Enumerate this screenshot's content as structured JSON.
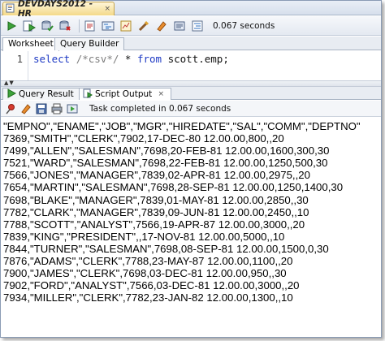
{
  "doc_tab": {
    "label": "DEVDAYS2012 - HR",
    "close": "×"
  },
  "toolbar": {
    "icons": [
      "run-statement-icon",
      "run-script-icon",
      "commit-icon",
      "rollback-icon",
      "unshared-worksheet-icon",
      "explain-plan-icon",
      "autotrace-icon",
      "sql-tuning-icon",
      "clear-icon",
      "history-icon",
      "format-icon"
    ],
    "elapsed": "0.067 seconds"
  },
  "sub_tabs": [
    "Worksheet",
    "Query Builder"
  ],
  "editor": {
    "line_number": "1",
    "tokens": {
      "kw1": "select",
      "comment": "/*csv*/",
      "star": " * ",
      "kw2": "from",
      "rest": " scott.emp;"
    }
  },
  "result_tabs": [
    {
      "label": "Query Result",
      "close": "×"
    },
    {
      "label": "Script Output",
      "close": "×"
    }
  ],
  "result_toolbar": {
    "status": "Task completed in 0.067 seconds"
  },
  "output_lines": [
    "\"EMPNO\",\"ENAME\",\"JOB\",\"MGR\",\"HIREDATE\",\"SAL\",\"COMM\",\"DEPTNO\"",
    "7369,\"SMITH\",\"CLERK\",7902,17-DEC-80 12.00.00,800,,20",
    "7499,\"ALLEN\",\"SALESMAN\",7698,20-FEB-81 12.00.00,1600,300,30",
    "7521,\"WARD\",\"SALESMAN\",7698,22-FEB-81 12.00.00,1250,500,30",
    "7566,\"JONES\",\"MANAGER\",7839,02-APR-81 12.00.00,2975,,20",
    "7654,\"MARTIN\",\"SALESMAN\",7698,28-SEP-81 12.00.00,1250,1400,30",
    "7698,\"BLAKE\",\"MANAGER\",7839,01-MAY-81 12.00.00,2850,,30",
    "7782,\"CLARK\",\"MANAGER\",7839,09-JUN-81 12.00.00,2450,,10",
    "7788,\"SCOTT\",\"ANALYST\",7566,19-APR-87 12.00.00,3000,,20",
    "7839,\"KING\",\"PRESIDENT\",,17-NOV-81 12.00.00,5000,,10",
    "7844,\"TURNER\",\"SALESMAN\",7698,08-SEP-81 12.00.00,1500,0,30",
    "7876,\"ADAMS\",\"CLERK\",7788,23-MAY-87 12.00.00,1100,,20",
    "7900,\"JAMES\",\"CLERK\",7698,03-DEC-81 12.00.00,950,,30",
    "7902,\"FORD\",\"ANALYST\",7566,03-DEC-81 12.00.00,3000,,20",
    "7934,\"MILLER\",\"CLERK\",7782,23-JAN-82 12.00.00,1300,,10"
  ]
}
